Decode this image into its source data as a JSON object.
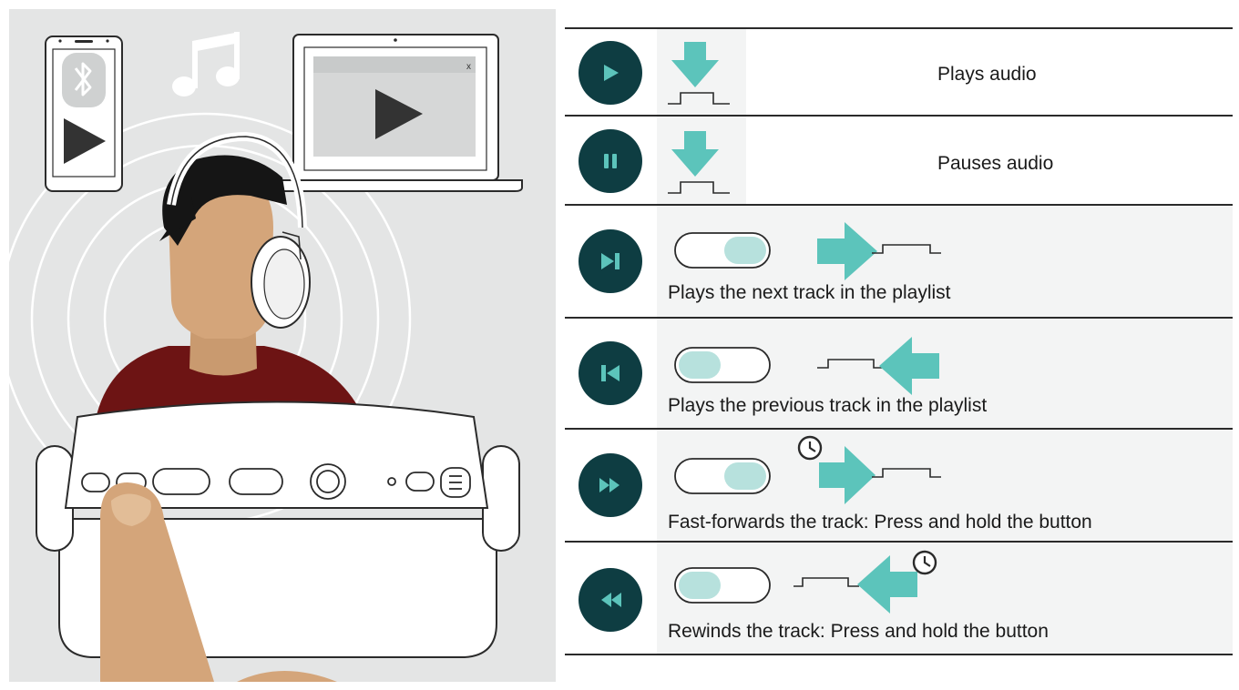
{
  "illustration": {
    "laptop_close_mark": "x",
    "icons": [
      "smartphone-icon",
      "bluetooth-icon",
      "music-note-icon",
      "laptop-icon",
      "play-icon",
      "headset-icon",
      "finger-icon"
    ]
  },
  "colors": {
    "control_button": "#0e3d42",
    "arrow": "#5cc4bb",
    "slider_knob": "#b7e1dd",
    "background_panel": "#e4e5e5",
    "shirt": "#6d1414",
    "skin": "#d4a57a"
  },
  "rows": [
    {
      "icon": "play-icon",
      "action": "press-button",
      "label": "Plays audio"
    },
    {
      "icon": "pause-icon",
      "action": "press-button",
      "label": "Pauses audio"
    },
    {
      "icon": "next-track-icon",
      "action": "slide-right",
      "label": "Plays the next track in the playlist"
    },
    {
      "icon": "previous-track-icon",
      "action": "slide-left",
      "label": "Plays the previous track in the playlist"
    },
    {
      "icon": "fast-forward-icon",
      "action": "slide-right-hold",
      "label": "Fast-forwards the track: Press and hold the button"
    },
    {
      "icon": "rewind-icon",
      "action": "slide-left-hold",
      "label": "Rewinds the track: Press and hold the button"
    }
  ]
}
